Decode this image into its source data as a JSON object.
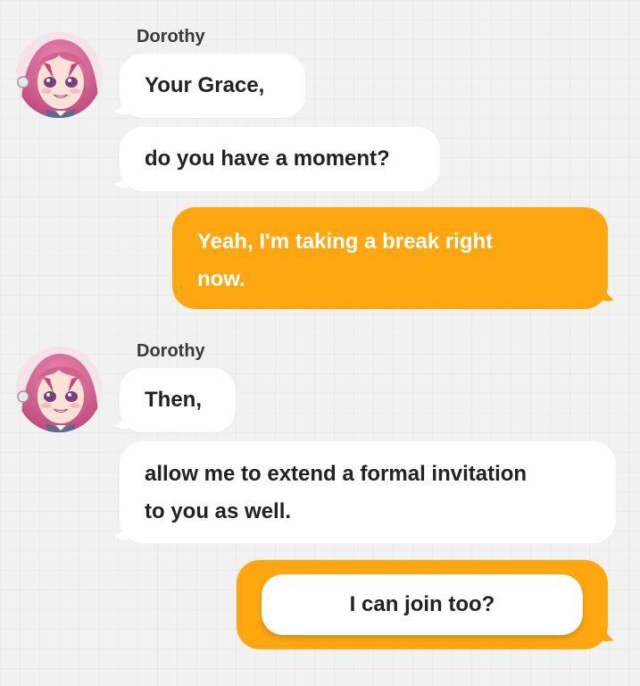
{
  "chat": {
    "group1": {
      "sender": "Dorothy",
      "avatar_icon": "dorothy-avatar",
      "messages": [
        "Your Grace,",
        "do you have a moment?"
      ]
    },
    "reply1": {
      "text_line1": "Yeah, I'm taking a break right",
      "text_line2": "now."
    },
    "group2": {
      "sender": "Dorothy",
      "avatar_icon": "dorothy-avatar",
      "messages": [
        "Then,"
      ],
      "long_line1": "allow me to extend a formal invitation",
      "long_line2": "to you as well."
    },
    "choice": {
      "label": "I can join too?"
    }
  },
  "colors": {
    "player_bubble": "#fea711",
    "npc_bubble": "#ffffff",
    "background": "#f1f1f1"
  }
}
